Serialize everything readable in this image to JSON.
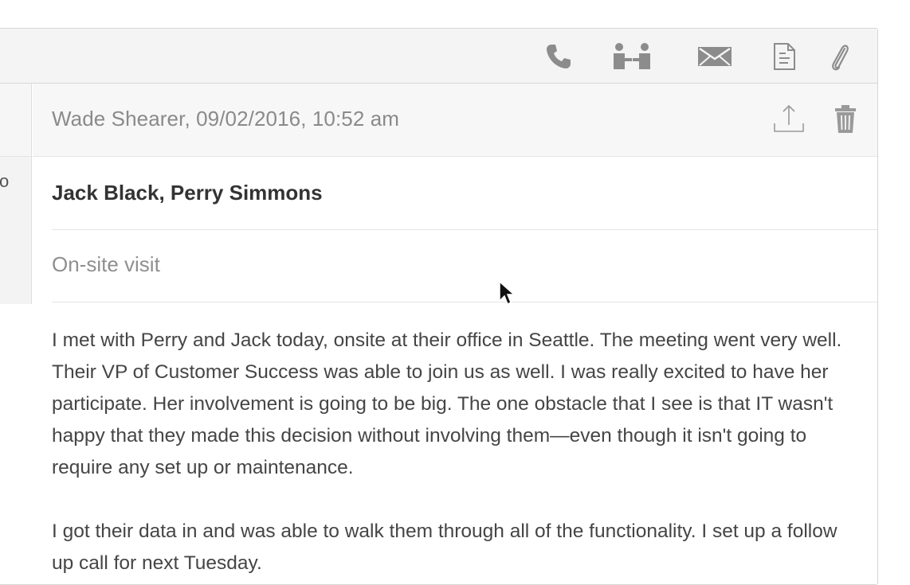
{
  "toolbar": {
    "icons": [
      "phone-icon",
      "meeting-icon",
      "email-icon",
      "document-icon",
      "paperclip-icon"
    ]
  },
  "left_panel": {
    "partial_glyph": "o"
  },
  "note": {
    "meta": "Wade Shearer, 09/02/2016, 10:52 am",
    "actions": [
      "share-upload-icon",
      "trash-icon"
    ],
    "attendees": "Jack Black, Perry Simmons",
    "subject": "On-site visit",
    "paragraphs": [
      "I met with Perry and Jack today, onsite at their office in Seattle. The meeting went very well. Their VP of Customer Success was able to join us as well. I was really excited to have her participate. Her involvement is going to be big. The one obstacle that I see is that IT wasn't happy that they made this decision without involving them—even though it isn't going to require any set up or maintenance.",
      "I got their data in and was able to walk them through all of the functionality. I set up a follow up call for next Tuesday."
    ]
  },
  "colors": {
    "toolbar_bg": "#f4f4f4",
    "icon": "#8c8c8c",
    "border": "#d6d6d6",
    "text": "#454545",
    "muted": "#8a8a8a"
  }
}
